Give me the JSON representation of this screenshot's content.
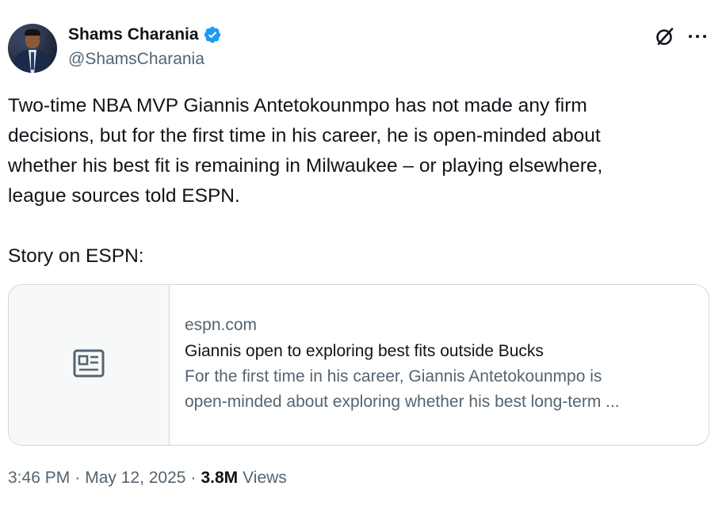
{
  "author": {
    "display_name": "Shams Charania",
    "handle": "@ShamsCharania",
    "verified": true
  },
  "tweet": {
    "text_lines": [
      "Two-time NBA MVP Giannis Antetokounmpo has not made any firm",
      "decisions, but for the first time in his career, he is open-minded about",
      "whether his best fit is remaining in Milwaukee – or playing elsewhere,",
      "league sources told ESPN."
    ],
    "text_tail": "Story on ESPN:"
  },
  "link_card": {
    "domain": "espn.com",
    "title": "Giannis open to exploring best fits outside Bucks",
    "description_lines": [
      "For the first time in his career, Giannis Antetokounmpo is",
      "open-minded about exploring whether his best long-term ..."
    ],
    "thumbnail_icon": "news-article-icon"
  },
  "meta": {
    "time": "3:46 PM",
    "sep1": "·",
    "date": "May 12, 2025",
    "sep2": "·",
    "views_count": "3.8M",
    "views_label": "Views"
  },
  "icons": {
    "verified": "verified-badge-icon",
    "grok": "grok-icon",
    "more": "more-options-icon"
  },
  "colors": {
    "primary_text": "#0f1419",
    "secondary_text": "#536471",
    "verified_blue": "#1d9bf0",
    "border": "#cfd9de",
    "card_thumb_bg": "#f7f9f9"
  }
}
